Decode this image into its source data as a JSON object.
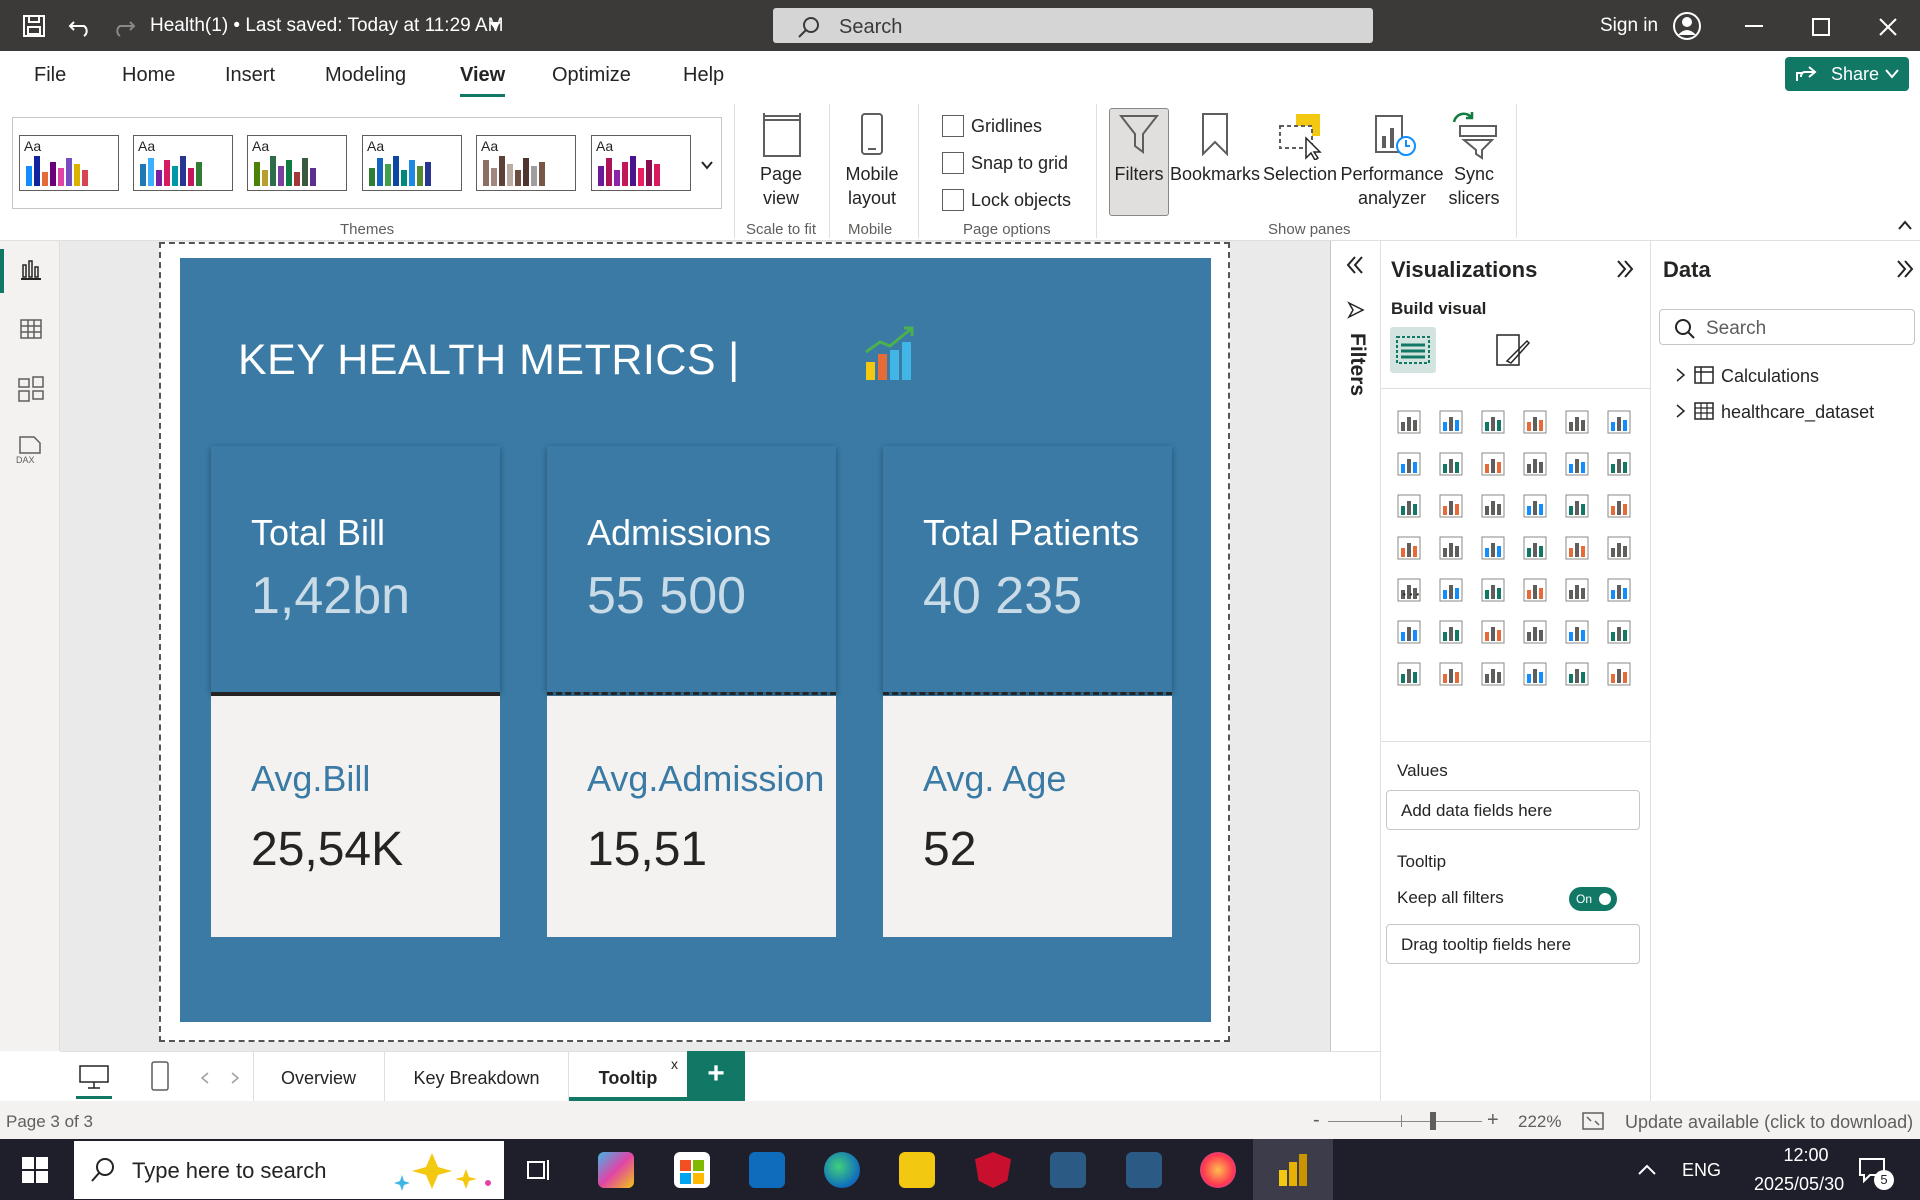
{
  "titlebar": {
    "title": "Health(1) • Last saved: Today at 11:29 AM",
    "search_placeholder": "Search",
    "sign_in": "Sign in"
  },
  "menu": {
    "items": [
      "File",
      "Home",
      "Insert",
      "Modeling",
      "View",
      "Optimize",
      "Help"
    ],
    "active": "View",
    "share": "Share"
  },
  "ribbon": {
    "themes_group": "Themes",
    "theme_label": "Aa",
    "page_view": "Page view",
    "scale_group": "Scale to fit",
    "mobile_layout": "Mobile layout",
    "mobile_group": "Mobile",
    "page_options": [
      "Gridlines",
      "Snap to grid",
      "Lock objects"
    ],
    "page_options_group": "Page options",
    "show_panes": [
      "Filters",
      "Bookmarks",
      "Selection",
      "Performance analyzer",
      "Sync slicers"
    ],
    "show_panes_group": "Show panes"
  },
  "report": {
    "title": "KEY HEALTH METRICS",
    "divider": "|",
    "cards": [
      {
        "top_label": "Total Bill",
        "top_value": "1,42bn",
        "bottom_label": "Avg.Bill",
        "bottom_value": "25,54K"
      },
      {
        "top_label": "Admissions",
        "top_value": "55 500",
        "bottom_label": "Avg.Admission",
        "bottom_value": "15,51"
      },
      {
        "top_label": "Total Patients",
        "top_value": "40 235",
        "bottom_label": "Avg. Age",
        "bottom_value": "52"
      }
    ]
  },
  "filters_pane": {
    "label": "Filters"
  },
  "visualizations": {
    "title": "Visualizations",
    "build_visual": "Build visual",
    "more": "···",
    "values_label": "Values",
    "values_placeholder": "Add data fields here",
    "tooltip_label": "Tooltip",
    "keep_filters": "Keep all filters",
    "toggle": "On",
    "tooltip_placeholder": "Drag tooltip fields here"
  },
  "data_pane": {
    "title": "Data",
    "search_placeholder": "Search",
    "tables": [
      "Calculations",
      "healthcare_dataset"
    ]
  },
  "page_tabs": {
    "tabs": [
      "Overview",
      "Key Breakdown",
      "Tooltip"
    ],
    "active": "Tooltip",
    "close": "x",
    "add": "+"
  },
  "status": {
    "page": "Page 3 of 3",
    "zoom_minus": "-",
    "zoom_plus": "+",
    "zoom": "222%",
    "update": "Update available (click to download)"
  },
  "taskbar": {
    "search_placeholder": "Type here to search",
    "lang": "ENG",
    "time": "12:00",
    "date": "2025/05/30",
    "notifications": "5"
  },
  "colors": {
    "accent": "#117865",
    "report_bg": "#3a7aa4",
    "card_bottom": "#f3f2f1"
  }
}
